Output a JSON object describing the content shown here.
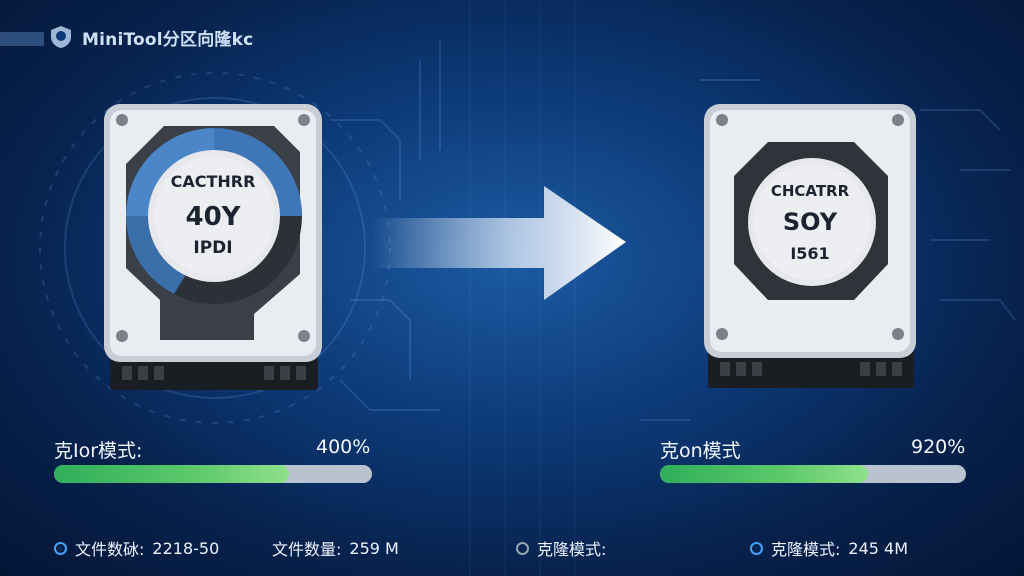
{
  "app": {
    "brand": "MiniTool分区向隆kc"
  },
  "source_disk": {
    "brand": "CACTHRR",
    "capacity": "40Y",
    "model": "IPDI"
  },
  "target_disk": {
    "brand": "CHCATRR",
    "capacity": "SOY",
    "model": "I561"
  },
  "left_mode": {
    "label": "克Ior模式:",
    "percent": "400%",
    "progress": 0.74
  },
  "right_mode": {
    "label": "克on模式",
    "percent": "920%",
    "progress": 0.68
  },
  "stats": {
    "s1_label": "文件数砅:",
    "s1_value": "2218-50",
    "s2_label": "文件数量:",
    "s2_value": "259 M",
    "s3_label": "克隆模式:",
    "s4_label": "克隆模式:",
    "s4_value": "245 4M"
  },
  "colors": {
    "accent": "#3fa3ff",
    "progress": "#5ec96c",
    "background": "#0d3a78"
  }
}
